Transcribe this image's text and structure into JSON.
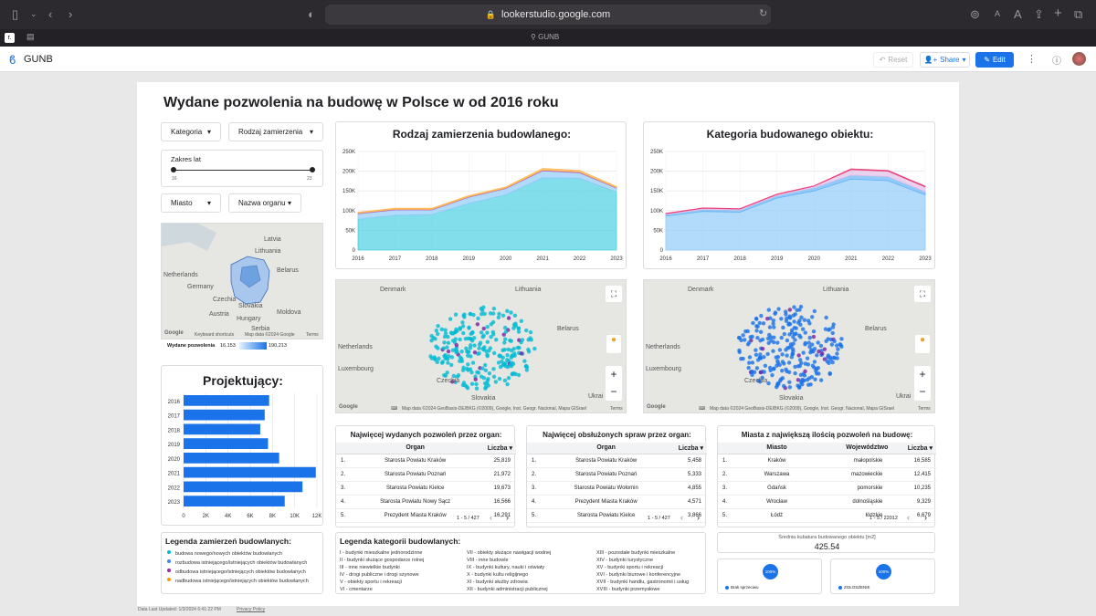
{
  "browser": {
    "url": "lookerstudio.google.com",
    "tab_title": "GUNB",
    "font_a_small": "A",
    "font_a_large": "A"
  },
  "app": {
    "name": "GUNB",
    "reset_label": "Reset",
    "share_label": "Share",
    "edit_label": "Edit"
  },
  "report": {
    "title": "Wydane pozwolenia na budowę w Polsce w od 2016 roku",
    "controls": {
      "kategoria": "Kategoria",
      "rodzaj": "Rodzaj zamierzenia",
      "zakres_label": "Zakres lat",
      "zakres_min": "16",
      "zakres_max": "23",
      "miasto": "Miasto",
      "organ": "Nazwa organu"
    },
    "small_map": {
      "countries": [
        "Latvia",
        "Lithuania",
        "Belarus",
        "Netherlands",
        "Germany",
        "Czechia",
        "Slovakia",
        "Austria",
        "Hungary",
        "Moldova",
        "Serbia"
      ],
      "footer_shortcuts": "Keyboard shortcuts",
      "footer_data": "Map data ©2024 Google",
      "footer_terms": "Terms",
      "legend_label": "Wydane pozwolenia",
      "legend_min": "16,153",
      "legend_max": "190,213"
    },
    "big_map": {
      "countries": [
        "Denmark",
        "Lithuania",
        "Belarus",
        "Netherlands",
        "Luxembourg",
        "Czechia",
        "Slovakia",
        "Ukrai"
      ],
      "footer": "Map data ©2024 GeoBasis-DE/BKG (©2009), Google, Inst. Geogr. Nacional, Mapa GISrael",
      "footer_terms": "Terms",
      "google": "Google"
    },
    "projektujacy_title": "Projektujący:",
    "legend_zamierzen": {
      "title": "Legenda zamierzeń budowlanych:",
      "items": [
        {
          "label": "budowa nowego/nowych obiektów budowlanych",
          "color": "#00bcd4"
        },
        {
          "label": "rozbudowa istniejącego/istniejących obiektów budowlanych",
          "color": "#4285f4"
        },
        {
          "label": "odbudowa istniejącego/istniejących obiektów budowlanych",
          "color": "#9c27b0"
        },
        {
          "label": "nadbudowa istniejącego/istniejących obiektów budowlanych",
          "color": "#ff9800"
        }
      ]
    },
    "legend_kategorii": {
      "title": "Legenda kategorii budowlanych:",
      "col1": [
        "I - budynki mieszkalne jednorodzinne",
        "II - budynki służące gospodarce rolnej",
        "III - inne niewielkie budynki",
        "IV - drogi publiczne i drogi szynowe",
        "V - obiekty sportu i rekreacji",
        "VI - cmentarze"
      ],
      "col2": [
        "VII - obiekty służące nawigacji wodnej",
        "VIII - inne budowle",
        "IX - budynki kultury, nauki i oświaty",
        "X - budynki kultu religijnego",
        "XI - budynki służby zdrowia",
        "XII - budynki administracji publicznej"
      ],
      "col3": [
        "XIII - pozostałe budynki mieszkalne",
        "XIV - budynki turystyczne",
        "XV - budynki sportu i rekreacji",
        "XVI - budynki biurowe i konferencyjne",
        "XVII - budynki handlu, gastronomii i usług",
        "XVIII - budynki przemysłowe"
      ]
    },
    "table1": {
      "title": "Najwięcej wydanych pozwoleń przez organ:",
      "col1": "Organ",
      "col2": "Liczba",
      "rows": [
        {
          "n": "1.",
          "a": "Starosta Powiatu Krakόw",
          "b": "25,819"
        },
        {
          "n": "2.",
          "a": "Starosta Powiatu Poznań",
          "b": "21,972"
        },
        {
          "n": "3.",
          "a": "Starosta Powiatu Kielce",
          "b": "19,673"
        },
        {
          "n": "4.",
          "a": "Starosta Powiatu Nowy Sącz",
          "b": "16,566"
        },
        {
          "n": "5.",
          "a": "Prezydent Miasta Kraków",
          "b": "16,291"
        }
      ],
      "pager": "1 - 5 / 427"
    },
    "table2": {
      "title": "Najwięcej obsłużonych spraw przez organ:",
      "col1": "Organ",
      "col2": "Liczba",
      "rows": [
        {
          "n": "1.",
          "a": "Starosta Powiatu Kraków",
          "b": "5,458"
        },
        {
          "n": "2.",
          "a": "Starosta Powiatu Poznań",
          "b": "5,333"
        },
        {
          "n": "3.",
          "a": "Starosta Powiatu Wołomin",
          "b": "4,855"
        },
        {
          "n": "4.",
          "a": "Prezydent Miasta Kraków",
          "b": "4,571"
        },
        {
          "n": "5.",
          "a": "Starosta Powiatu Kielce",
          "b": "3,866"
        }
      ],
      "pager": "1 - 5 / 427"
    },
    "table3": {
      "title": "Miasta z największą ilością pozwoleń na budowę:",
      "col1": "Miasto",
      "col2": "Województwo",
      "col3": "Liczba",
      "rows": [
        {
          "n": "1.",
          "a": "Kraków",
          "c": "małopolskie",
          "b": "16,585"
        },
        {
          "n": "2.",
          "a": "Warszawa",
          "c": "mazowieckie",
          "b": "12,415"
        },
        {
          "n": "3.",
          "a": "Gdańsk",
          "c": "pomorskie",
          "b": "10,235"
        },
        {
          "n": "4.",
          "a": "Wrocław",
          "c": "dolnośląskie",
          "b": "9,329"
        },
        {
          "n": "5.",
          "a": "Łódź",
          "c": "łódzkie",
          "b": "6,679"
        }
      ],
      "pager": "1 - 5 / 22012"
    },
    "scorecard": {
      "label": "Średnia kubatura budowanego obiektu [m2]",
      "value": "425.54"
    },
    "pie1": {
      "label": "Brak sprzeciwu",
      "value": "100%"
    },
    "pie2": {
      "label": "ZGŁOSZENIE",
      "value": "100%"
    },
    "footer": {
      "updated": "Data Last Updated: 1/3/2024 6:41:22 PM",
      "privacy": "Privacy Policy"
    }
  },
  "chart_data": [
    {
      "type": "area",
      "title": "Rodzaj zamierzenia budowlanego:",
      "x": [
        "2016",
        "2017",
        "2018",
        "2019",
        "2020",
        "2021",
        "2022",
        "2023"
      ],
      "ylim": [
        0,
        250000
      ],
      "yticks": [
        "0",
        "50K",
        "100K",
        "150K",
        "200K",
        "250K"
      ],
      "series": [
        {
          "values": [
            78000,
            88000,
            90000,
            118000,
            140000,
            183000,
            182000,
            147000
          ],
          "color": "#4dd0e1"
        },
        {
          "values": [
            14000,
            14000,
            12000,
            16000,
            16000,
            18000,
            14000,
            10000
          ],
          "color": "#90caf9"
        },
        {
          "values": [
            1500,
            1500,
            1500,
            1500,
            1500,
            2000,
            2000,
            1500
          ],
          "color": "#ba68c8"
        },
        {
          "values": [
            2500,
            2500,
            2500,
            2500,
            2500,
            4000,
            4000,
            2500
          ],
          "color": "#ffb74d"
        }
      ]
    },
    {
      "type": "area",
      "title": "Kategoria budowanego obiektu:",
      "x": [
        "2016",
        "2017",
        "2018",
        "2019",
        "2020",
        "2021",
        "2022",
        "2023"
      ],
      "ylim": [
        0,
        250000
      ],
      "yticks": [
        "0",
        "50K",
        "100K",
        "150K",
        "200K",
        "250K"
      ],
      "series": [
        {
          "values": [
            86000,
            98000,
            96000,
            132000,
            150000,
            180000,
            176000,
            140000
          ],
          "color": "#90caf9"
        },
        {
          "values": [
            4000,
            5000,
            5000,
            6000,
            8000,
            10000,
            10000,
            8000
          ],
          "color": "#64b5f6"
        },
        {
          "values": [
            2000,
            3000,
            3000,
            3000,
            4000,
            14000,
            14000,
            12000
          ],
          "color": "#e1bee7"
        },
        {
          "values": [
            1000,
            1000,
            1000,
            1000,
            1000,
            2000,
            2000,
            2000
          ],
          "color": "#ec407a"
        }
      ]
    },
    {
      "type": "bar",
      "title": "Projektujący:",
      "categories": [
        "2016",
        "2017",
        "2018",
        "2019",
        "2020",
        "2021",
        "2022",
        "2023"
      ],
      "values": [
        7700,
        7300,
        6900,
        7600,
        8600,
        11900,
        10700,
        9100
      ],
      "xlim": [
        0,
        12000
      ],
      "xticks": [
        "0",
        "2K",
        "4K",
        "6K",
        "8K",
        "10K",
        "12K"
      ],
      "color": "#1a73e8"
    }
  ]
}
